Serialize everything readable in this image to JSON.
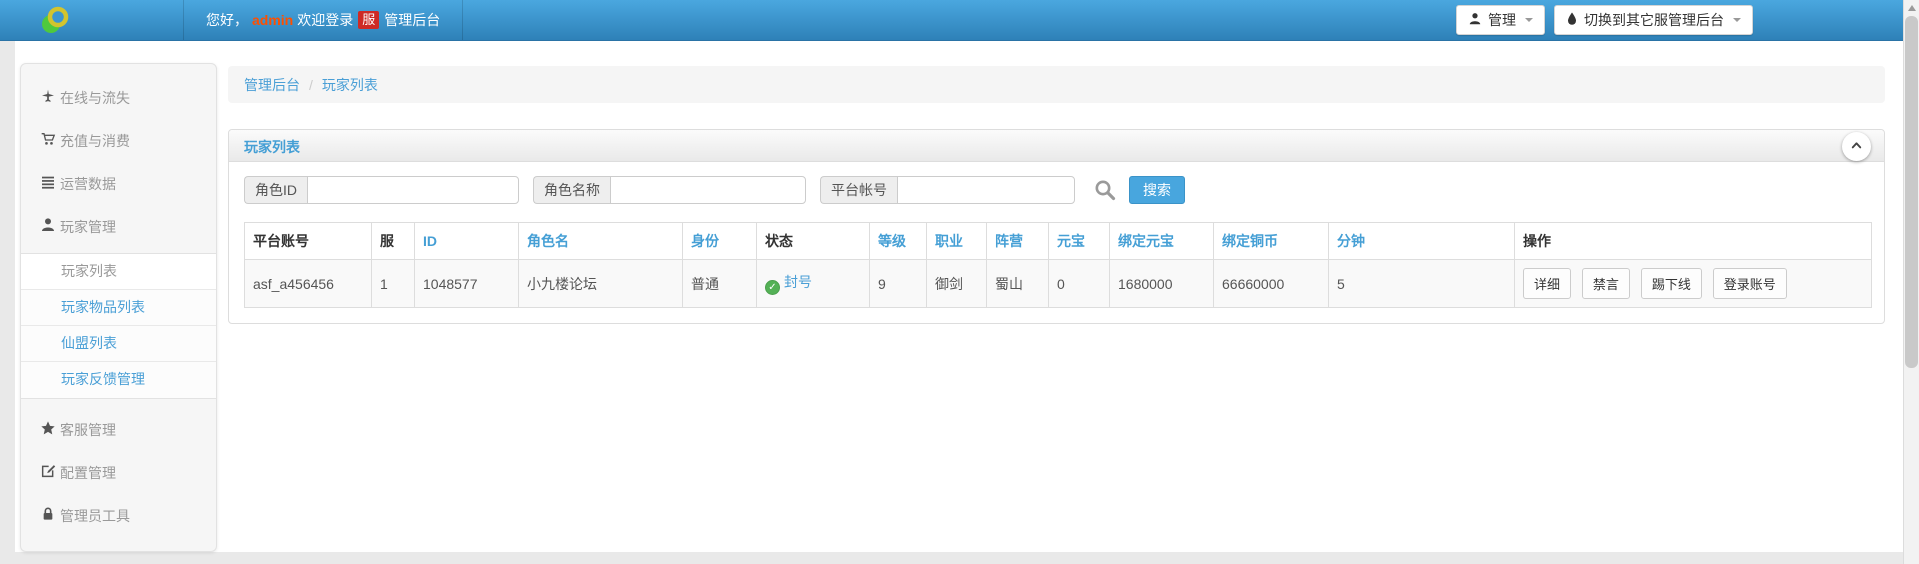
{
  "navbar": {
    "welcome_prefix": "您好，",
    "username": "admin",
    "welcome_mid": "欢迎登录",
    "server_badge": "服",
    "welcome_suffix": "管理后台",
    "admin_menu": "管理",
    "switch_menu": "切换到其它服管理后台",
    "icons": [
      "brand-rings-icon",
      "user-icon",
      "droplet-icon",
      "caret-down-icon"
    ]
  },
  "sidebar": {
    "groups": [
      {
        "label": "在线与流失",
        "icon": "plane-icon"
      },
      {
        "label": "充值与消费",
        "icon": "cart-icon"
      },
      {
        "label": "运营数据",
        "icon": "list-icon"
      },
      {
        "label": "玩家管理",
        "icon": "user-icon"
      }
    ],
    "player_submenu": [
      {
        "label": "玩家列表",
        "active": true
      },
      {
        "label": "玩家物品列表",
        "active": false
      },
      {
        "label": "仙盟列表",
        "active": false
      },
      {
        "label": "玩家反馈管理",
        "active": false
      }
    ],
    "groups_bottom": [
      {
        "label": "客服管理",
        "icon": "star-icon"
      },
      {
        "label": "配置管理",
        "icon": "edit-icon"
      },
      {
        "label": "管理员工具",
        "icon": "lock-icon"
      }
    ]
  },
  "breadcrumb": {
    "root": "管理后台",
    "separator": "/",
    "current": "玩家列表"
  },
  "panel": {
    "title": "玩家列表",
    "collapse_icon": "chevron-up-icon",
    "search": {
      "fields": [
        {
          "label": "角色ID",
          "value": ""
        },
        {
          "label": "角色名称",
          "value": ""
        },
        {
          "label": "平台帐号",
          "value": ""
        }
      ],
      "magnifier_icon": "magnifier-icon",
      "button": "搜索"
    },
    "table": {
      "headers": [
        "平台账号",
        "服",
        "ID",
        "角色名",
        "身份",
        "状态",
        "等级",
        "职业",
        "阵营",
        "元宝",
        "绑定元宝",
        "绑定铜币",
        "分钟",
        "操作"
      ],
      "row": {
        "platform_account": "asf_a456456",
        "server": "1",
        "id": "1048577",
        "role_name": "小九楼论坛",
        "identity": "普通",
        "status": "封号",
        "status_icon": "check-circle-icon",
        "status_check_glyph": "✓",
        "level": "9",
        "profession": "御剑",
        "faction": "蜀山",
        "yuanbao": "0",
        "bound_yuanbao": "1680000",
        "bound_copper": "66660000",
        "minutes": "5",
        "actions": [
          "详细",
          "禁言",
          "踢下线",
          "登录账号"
        ]
      }
    }
  },
  "colors": {
    "navbar_top": "#4aa7df",
    "navbar_bottom": "#2e81b8",
    "link_blue": "#4a9fd6",
    "username_orange": "#fe5000",
    "badge_red": "#ce2a26",
    "search_button_blue": "#48a6de",
    "status_green": "#54b156"
  }
}
